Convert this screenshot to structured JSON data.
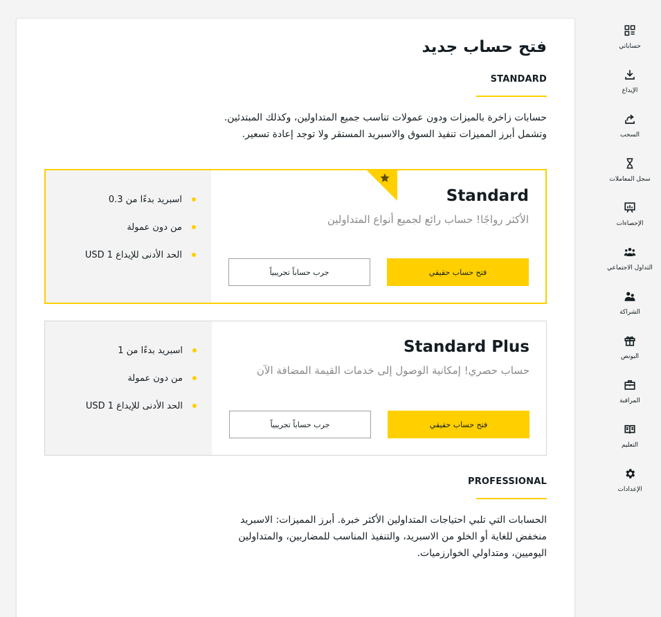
{
  "sidebar": {
    "items": [
      {
        "label": "حساباتي",
        "icon": "accounts-icon"
      },
      {
        "label": "الإيداع",
        "icon": "deposit-icon"
      },
      {
        "label": "السحب",
        "icon": "withdraw-icon"
      },
      {
        "label": "سجل المعاملات",
        "icon": "hourglass-icon"
      },
      {
        "label": "الإحصاءات",
        "icon": "statistics-icon"
      },
      {
        "label": "التداول الاجتماعي",
        "icon": "social-trading-icon"
      },
      {
        "label": "الشراكة",
        "icon": "partnership-icon"
      },
      {
        "label": "البونص",
        "icon": "gift-icon"
      },
      {
        "label": "المراقبة",
        "icon": "briefcase-icon"
      },
      {
        "label": "التعليم",
        "icon": "book-icon"
      },
      {
        "label": "الإعدادات",
        "icon": "gear-icon"
      }
    ]
  },
  "main": {
    "title": "فتح حساب جديد",
    "standard_section": {
      "heading": "STANDARD",
      "description": "حسابات زاخرة بالميزات ودون عمولات تناسب جميع المتداولين، وكذلك المبتدئين. وتشمل أبرز المميزات تنفيذ السوق والاسبريد المستقر ولا توجد إعادة تسعير."
    },
    "cards": [
      {
        "name": "Standard",
        "tagline": "الأكثر رواجًا! حساب رائع لجميع أنواع المتداولين",
        "real_button": "فتح حساب حقيقي",
        "demo_button": "جرب حساباً تجريبياً",
        "features": [
          "اسبريد بدءًا من 0.3",
          "من دون عمولة",
          "الحد الأدنى للإيداع 1 USD"
        ],
        "featured": true
      },
      {
        "name": "Standard Plus",
        "tagline": "حساب حصري! إمكانية الوصول إلى خدمات القيمة المضافة الآن",
        "real_button": "فتح حساب حقيقي",
        "demo_button": "جرب حساباً تجريبياً",
        "features": [
          "اسبريد بدءًا من 1",
          "من دون عمولة",
          "الحد الأدنى للإيداع 1 USD"
        ],
        "featured": false
      }
    ],
    "professional_section": {
      "heading": "PROFESSIONAL",
      "description": "الحسابات التي تلبي احتياجات المتداولين الأكثر خبرة. أبرز المميزات: الاسبريد منخفض للغاية أو الخلو من الاسبريد، والتنفيذ المناسب للمضاربين، والمتداولين اليوميين، ومتداولي الخوارزميات."
    }
  },
  "colors": {
    "accent": "#ffcf00",
    "text": "#141d22",
    "muted": "#8a8a8a",
    "feature_bg": "#f3f3f3"
  }
}
